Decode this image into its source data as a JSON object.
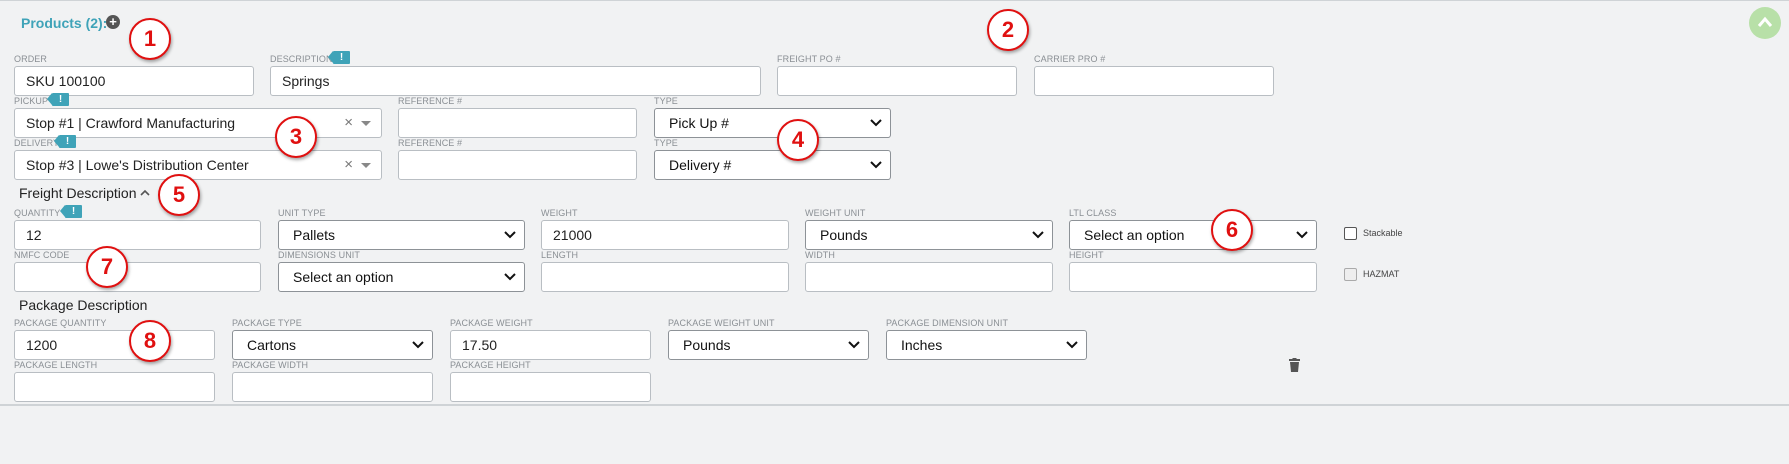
{
  "header": {
    "title": "Products (2):"
  },
  "labels": {
    "order": "ORDER",
    "description": "DESCRIPTION",
    "freight_po": "FREIGHT PO #",
    "carrier_pro": "CARRIER PRO #",
    "pickup": "PICKUP",
    "reference1": "REFERENCE #",
    "type1": "TYPE",
    "delivery": "DELIVERY",
    "reference2": "REFERENCE #",
    "type2": "TYPE",
    "quantity": "QUANTITY",
    "unit_type": "UNIT TYPE",
    "weight": "WEIGHT",
    "weight_unit": "WEIGHT UNIT",
    "ltl_class": "LTL CLASS",
    "stackable": "Stackable",
    "nmfc_code": "NMFC CODE",
    "dimensions_unit": "DIMENSIONS UNIT",
    "length": "LENGTH",
    "width": "WIDTH",
    "height": "HEIGHT",
    "hazmat": "HAZMAT",
    "package_quantity": "PACKAGE QUANTITY",
    "package_type": "PACKAGE TYPE",
    "package_weight": "PACKAGE WEIGHT",
    "package_weight_unit": "PACKAGE WEIGHT UNIT",
    "package_dimension_unit": "PACKAGE DIMENSION UNIT",
    "package_length": "PACKAGE LENGTH",
    "package_width": "PACKAGE WIDTH",
    "package_height": "PACKAGE HEIGHT"
  },
  "values": {
    "order": "SKU 100100",
    "description": "Springs",
    "freight_po": "",
    "carrier_pro": "",
    "pickup": "Stop #1 | Crawford Manufacturing",
    "reference1": "",
    "type1": "Pick Up #",
    "delivery": "Stop #3 | Lowe's Distribution Center",
    "reference2": "",
    "type2": "Delivery #",
    "quantity": "12",
    "unit_type": "Pallets",
    "weight": "21000",
    "weight_unit": "Pounds",
    "ltl_class": "Select an option",
    "nmfc_code": "",
    "dimensions_unit": "Select an option",
    "length": "",
    "width": "",
    "height": "",
    "package_quantity": "1200",
    "package_type": "Cartons",
    "package_weight": "17.50",
    "package_weight_unit": "Pounds",
    "package_dimension_unit": "Inches",
    "package_length": "",
    "package_width": "",
    "package_height": ""
  },
  "sections": {
    "freight": "Freight Description",
    "package": "Package Description"
  },
  "tag_glyph": "!",
  "callouts": [
    "1",
    "2",
    "3",
    "4",
    "5",
    "6",
    "7",
    "8"
  ],
  "icons": {
    "add": "plus-circle-icon",
    "collapse": "chevron-up-icon",
    "clear": "close-icon",
    "dropdown": "caret-down-icon",
    "delete": "trash-icon",
    "info": "info-tag-icon"
  },
  "colors": {
    "accent": "#3fa3b8",
    "callout": "#e01010",
    "collapse_button": "#b8e0a8"
  }
}
